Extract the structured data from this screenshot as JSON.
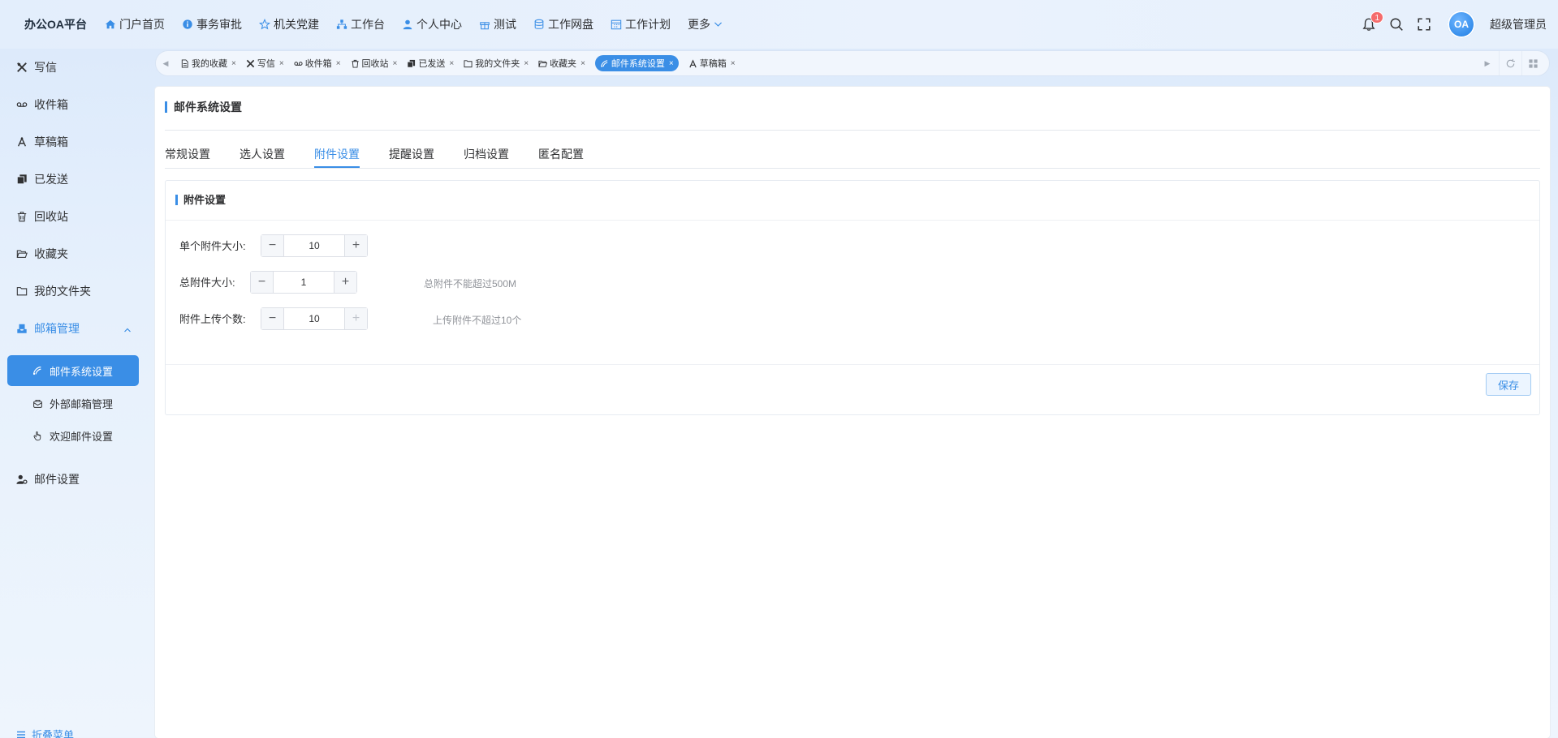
{
  "app": {
    "brand": "办公OA平台"
  },
  "topnav": {
    "items": [
      {
        "label": "门户首页",
        "icon": "home-icon"
      },
      {
        "label": "事务审批",
        "icon": "info-icon"
      },
      {
        "label": "机关党建",
        "icon": "star-icon"
      },
      {
        "label": "工作台",
        "icon": "org-chart-icon"
      },
      {
        "label": "个人中心",
        "icon": "user-icon"
      },
      {
        "label": "测试",
        "icon": "gift-icon"
      },
      {
        "label": "工作网盘",
        "icon": "database-icon"
      },
      {
        "label": "工作计划",
        "icon": "calendar-icon"
      }
    ],
    "more_label": "更多",
    "notification_count": "1",
    "avatar_text": "OA",
    "username": "超级管理员"
  },
  "sidebar": {
    "items": [
      {
        "label": "写信",
        "icon": "compose-icon"
      },
      {
        "label": "收件箱",
        "icon": "voicemail-icon"
      },
      {
        "label": "草稿箱",
        "icon": "draft-icon"
      },
      {
        "label": "已发送",
        "icon": "copy-icon"
      },
      {
        "label": "回收站",
        "icon": "trash-icon"
      },
      {
        "label": "收藏夹",
        "icon": "folder-open-icon"
      },
      {
        "label": "我的文件夹",
        "icon": "folder-icon"
      }
    ],
    "group": {
      "label": "邮箱管理",
      "icon": "inbox-tray-icon"
    },
    "sub_items": [
      {
        "label": "邮件系统设置",
        "icon": "satellite-icon",
        "active": true
      },
      {
        "label": "外部邮箱管理",
        "icon": "mailbox-icon"
      },
      {
        "label": "欢迎邮件设置",
        "icon": "hand-pointer-icon"
      }
    ],
    "mail_settings": {
      "label": "邮件设置",
      "icon": "user-gear-icon"
    },
    "collapse_label": "折叠菜单"
  },
  "tabs": [
    {
      "label": "我的收藏",
      "icon": "document-icon"
    },
    {
      "label": "写信",
      "icon": "compose-icon"
    },
    {
      "label": "收件箱",
      "icon": "voicemail-icon"
    },
    {
      "label": "回收站",
      "icon": "trash-icon"
    },
    {
      "label": "已发送",
      "icon": "copy-icon"
    },
    {
      "label": "我的文件夹",
      "icon": "folder-icon"
    },
    {
      "label": "收藏夹",
      "icon": "folder-open-icon"
    },
    {
      "label": "邮件系统设置",
      "icon": "satellite-icon",
      "active": true
    },
    {
      "label": "草稿箱",
      "icon": "draft-icon"
    }
  ],
  "page": {
    "title": "邮件系统设置",
    "sub_tabs": [
      "常规设置",
      "选人设置",
      "附件设置",
      "提醒设置",
      "归档设置",
      "匿名配置"
    ],
    "active_sub_tab": "附件设置",
    "card_title": "附件设置",
    "fields": [
      {
        "label": "单个附件大小:",
        "value": "10",
        "hint": ""
      },
      {
        "label": "总附件大小:",
        "value": "1",
        "hint": "总附件不能超过500M"
      },
      {
        "label": "附件上传个数:",
        "value": "10",
        "hint": "上传附件不超过10个"
      }
    ],
    "save_label": "保存"
  },
  "colors": {
    "accent": "#3a8ee6",
    "badge": "#f56c6c"
  }
}
